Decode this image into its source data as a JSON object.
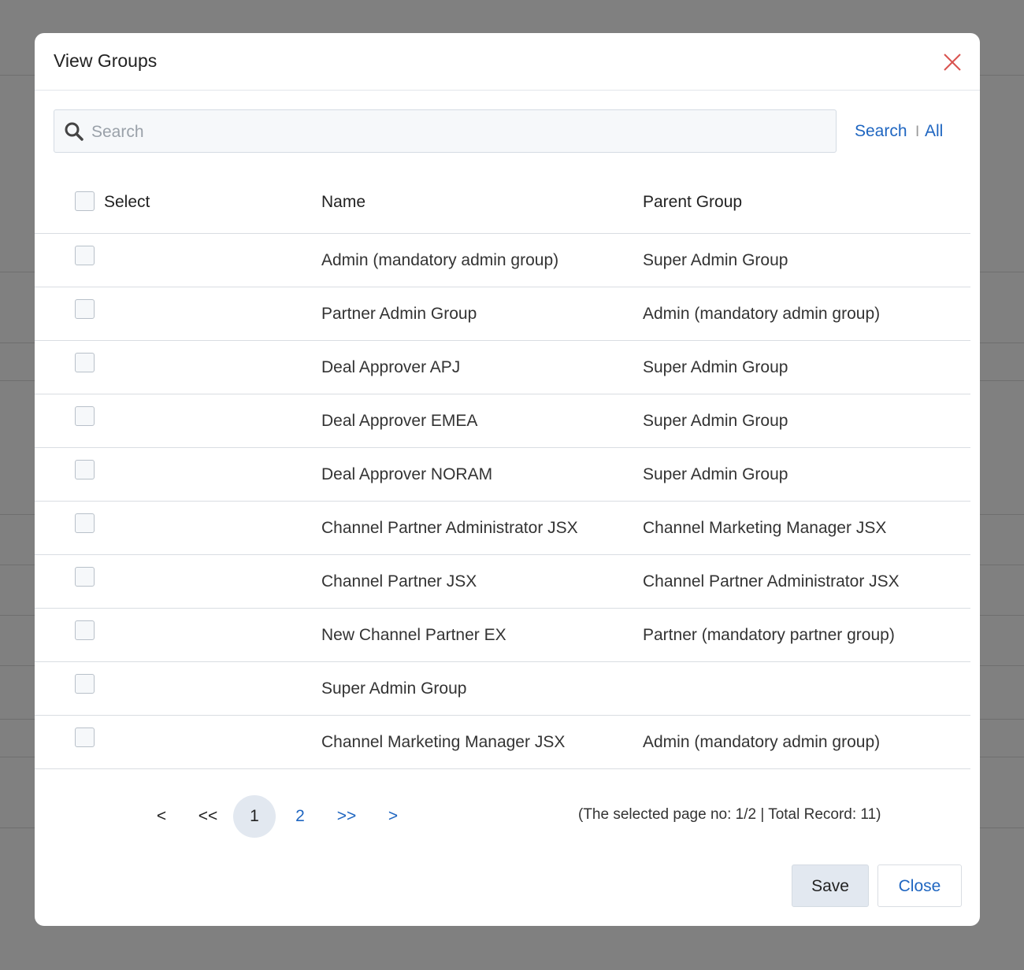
{
  "modal": {
    "title": "View Groups",
    "search_placeholder": "Search",
    "search_label": "Search",
    "separator": "I",
    "all_label": "All"
  },
  "table": {
    "headers": {
      "select": "Select",
      "name": "Name",
      "parent": "Parent Group"
    },
    "rows": [
      {
        "name": "Admin (mandatory admin group)",
        "parent": "Super Admin Group"
      },
      {
        "name": "Partner Admin Group",
        "parent": "Admin (mandatory admin group)"
      },
      {
        "name": "Deal Approver APJ",
        "parent": "Super Admin Group"
      },
      {
        "name": "Deal Approver EMEA",
        "parent": "Super Admin Group"
      },
      {
        "name": "Deal Approver NORAM",
        "parent": "Super Admin Group"
      },
      {
        "name": "Channel Partner Administrator JSX",
        "parent": "Channel Marketing Manager JSX"
      },
      {
        "name": "Channel Partner JSX",
        "parent": "Channel Partner Administrator JSX"
      },
      {
        "name": "New Channel Partner EX",
        "parent": "Partner (mandatory partner group)"
      },
      {
        "name": "Super Admin Group",
        "parent": ""
      },
      {
        "name": "Channel Marketing Manager JSX",
        "parent": "Admin (mandatory admin group)"
      }
    ]
  },
  "pagination": {
    "prev": "<",
    "first": "<<",
    "pages": [
      "1",
      "2"
    ],
    "last": ">>",
    "next": ">",
    "info": "(The selected page no: 1/2 | Total Record: 11)"
  },
  "buttons": {
    "save": "Save",
    "close": "Close"
  },
  "colors": {
    "link": "#1f66c1",
    "overlay": "#808080",
    "close_icon": "#d9534f"
  }
}
